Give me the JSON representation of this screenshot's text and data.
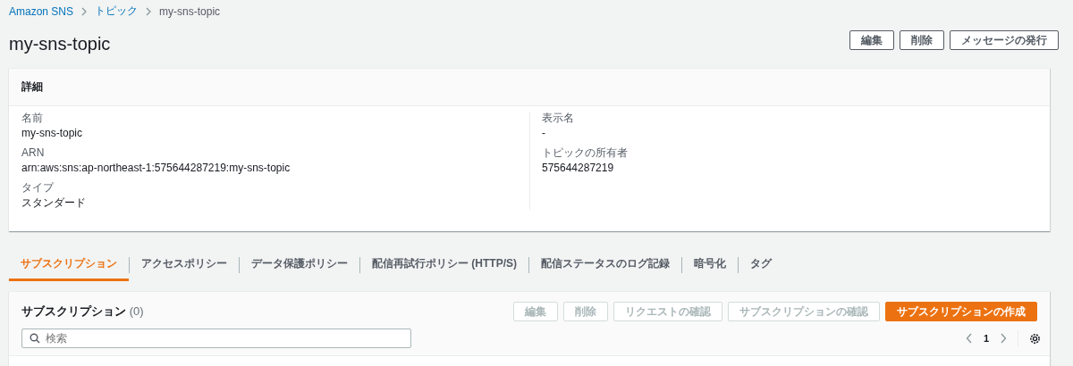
{
  "breadcrumbs": [
    {
      "label": "Amazon SNS",
      "link": true
    },
    {
      "label": "トピック",
      "link": true
    },
    {
      "label": "my-sns-topic",
      "link": false
    }
  ],
  "title": "my-sns-topic",
  "actions": [
    {
      "label": "編集"
    },
    {
      "label": "削除"
    },
    {
      "label": "メッセージの発行"
    }
  ],
  "details": {
    "title": "詳細",
    "columns": [
      [
        {
          "label": "名前",
          "value": "my-sns-topic"
        },
        {
          "label": "ARN",
          "value": "arn:aws:sns:ap-northeast-1:575644287219:my-sns-topic"
        },
        {
          "label": "タイプ",
          "value": "スタンダード"
        }
      ],
      [
        {
          "label": "表示名",
          "value": "-"
        },
        {
          "label": "トピックの所有者",
          "value": "575644287219"
        }
      ]
    ]
  },
  "tabs": [
    {
      "label": "サブスクリプション",
      "selected": true
    },
    {
      "label": "アクセスポリシー",
      "selected": false
    },
    {
      "label": "データ保護ポリシー",
      "selected": false
    },
    {
      "label": "配信再試行ポリシー (HTTP/S)",
      "selected": false
    },
    {
      "label": "配信ステータスのログ記録",
      "selected": false
    },
    {
      "label": "暗号化",
      "selected": false
    },
    {
      "label": "タグ",
      "selected": false
    }
  ],
  "subscriptions": {
    "title": "サブスクリプション",
    "count": "(0)",
    "buttons": [
      {
        "label": "編集",
        "kind": "normal",
        "disabled": true
      },
      {
        "label": "削除",
        "kind": "normal",
        "disabled": true
      },
      {
        "label": "リクエストの確認",
        "kind": "normal",
        "disabled": true
      },
      {
        "label": "サブスクリプションの確認",
        "kind": "normal",
        "disabled": true
      },
      {
        "label": "サブスクリプションの作成",
        "kind": "primary",
        "disabled": false
      }
    ],
    "search": {
      "placeholder": "検索"
    },
    "page": "1"
  }
}
